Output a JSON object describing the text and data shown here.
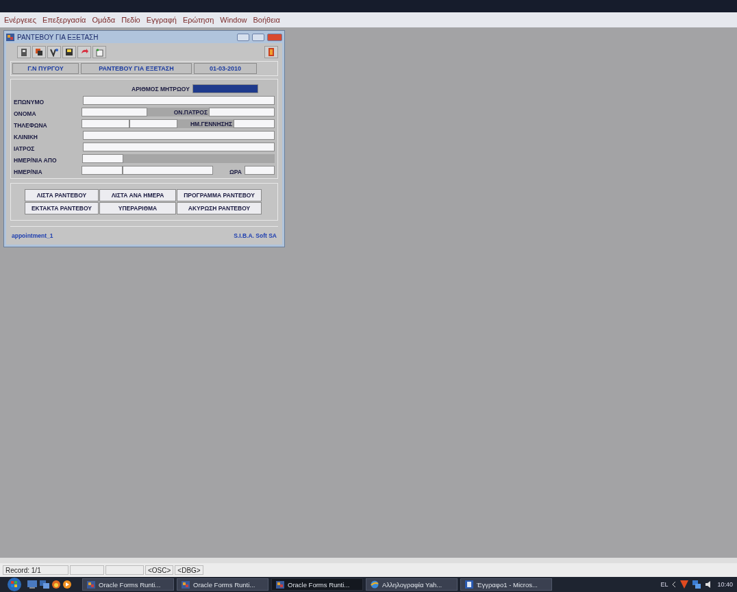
{
  "menu": [
    "Ενέργειες",
    "Επεξεργασία",
    "Ομάδα",
    "Πεδίο",
    "Εγγραφή",
    "Ερώτηση",
    "Window",
    "Βοήθεια"
  ],
  "window": {
    "title": "ΡΑΝΤΕΒΟΥ ΓΙΑ ΕΞΕΤΑΣΗ",
    "header": [
      "Γ.Ν ΠΥΡΓΟΥ",
      "ΡΑΝΤΕΒΟΥ ΓΙΑ ΕΞΕΤΑΣΗ",
      "01-03-2010"
    ],
    "form": {
      "registry_number": "ΑΡΙΘΜΟΣ ΜΗΤΡΩΟΥ",
      "surname": "ΕΠΩΝΥΜΟ",
      "first_name": "ΟΝΟΜΑ",
      "father_name": "ΟΝ.ΠΑΤΡΟΣ",
      "phone": "ΤΗΛΕΦΩΝΑ",
      "birth_date": "ΗΜ.ΓΕΝΝΗΣΗΣ",
      "clinic": "ΚΛΙΝΙΚΗ",
      "doctor": "ΙΑΤΡΟΣ",
      "date_from": "ΗΜΕΡ/ΝΙΑ ΑΠΟ",
      "date": "ΗΜΕΡ/ΝΙΑ",
      "time": "ΩΡΑ"
    },
    "buttons": [
      "ΛΙΣΤΑ ΡΑΝΤΕΒΟΥ",
      "ΛΙΣΤΑ ΑΝΑ ΗΜΕΡΑ",
      "ΠΡΟΓΡΑΜΜΑ ΡΑΝΤΕΒΟΥ",
      "ΕΚΤΑΚΤΑ ΡΑΝΤΕΒΟΥ",
      "ΥΠΕΡΑΡΙΘΜΑ",
      "ΑΚΥΡΩΣΗ ΡΑΝΤΕΒΟΥ"
    ],
    "footer": {
      "form_name": "appointment_1",
      "vendor": "S.I.B.A. Soft SA"
    }
  },
  "status_bar": {
    "record": "Record: 1/1",
    "osc": "<OSC>",
    "dbg": "<DBG>"
  },
  "taskbar": {
    "tasks": [
      {
        "kind": "forms",
        "label": "Oracle Forms Runti...",
        "selected": false
      },
      {
        "kind": "forms",
        "label": "Oracle Forms Runti...",
        "selected": false
      },
      {
        "kind": "forms",
        "label": "Oracle Forms Runti...",
        "selected": true
      },
      {
        "kind": "browser",
        "label": "Αλληλογραφία Yah...",
        "selected": false
      },
      {
        "kind": "word",
        "label": "Έγγραφο1 - Micros...",
        "selected": false
      }
    ],
    "language": "EL",
    "clock": "10:40"
  }
}
